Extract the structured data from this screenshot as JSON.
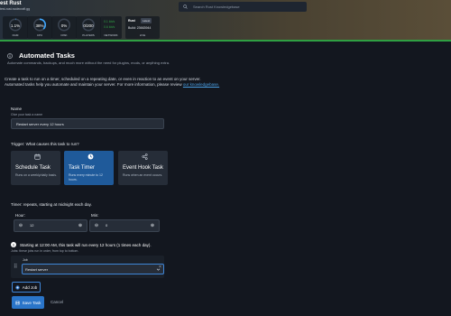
{
  "header": {
    "server_name": "est Rust",
    "server_address": "test-rust.nodecraft.gg",
    "search_placeholder": "Search Rust Knowledgebase",
    "stats": [
      {
        "value": "1.1%",
        "label": "RAM",
        "level": 0.011,
        "color": "#3fa7ff"
      },
      {
        "value": "38%",
        "label": "CPU",
        "level": 0.38,
        "color": "#3fa7ff"
      },
      {
        "value": "0%",
        "label": "DISK",
        "level": 0.0,
        "color": "#3fa7ff"
      },
      {
        "value": "0/200",
        "label": "PLAYERS",
        "level": 0.0,
        "color": "#3fa7ff"
      }
    ],
    "network": {
      "in": "0.1 kb/s",
      "out": "0.6 kb/s",
      "label": "NETWORK"
    },
    "version": {
      "name": "Rust",
      "chip": "Latest",
      "build": "Build: 23663944",
      "label": "LIVE"
    },
    "accent": "#2fa043"
  },
  "page": {
    "title": "Automated Tasks",
    "subtitle": "Automate commands, backups, and much more without the need for plugins, mods, or anything extra.",
    "intro_line1": "Create a task to run on a timer, scheduled on a repeating date, or even in reaction to an event on your server.",
    "intro_line2": "Automated tasks help you automate and maintain your server. For more information, please review",
    "intro_link": "our knowledgebase."
  },
  "form": {
    "name_label": "Name",
    "name_hint": "Give your task a name",
    "name_value": "Restart server every 12 hours",
    "trigger_label": "Trigger: What causes this task to run?",
    "triggers": [
      {
        "title": "Schedule Task",
        "desc": "Runs on a weekly/daily basis.",
        "icon": "calendar-icon",
        "active": false
      },
      {
        "title": "Task Timer",
        "desc": "Runs every minute to 12 hours.",
        "icon": "clock-icon",
        "active": true
      },
      {
        "title": "Event Hook Task",
        "desc": "Runs when an event occurs.",
        "icon": "share-icon",
        "active": false
      }
    ],
    "timer_label": "Timer: repeats, starting at midnight each day.",
    "hour_label": "Hour:",
    "hour_value": "12",
    "min_label": "Min:",
    "min_value": "0",
    "minus": "⊖",
    "plus": "⊕",
    "summary": "Starting at 12:00 AM, this task will run every 12 hours (1 times each day).",
    "summary_sub": "Jobs: these jobs run in order, from top to bottom.",
    "info_symbol": "!",
    "job_label": "Job",
    "job_value": "Restart server",
    "handle_symbol": "⠿",
    "remove_symbol": "×",
    "add_job": "Add Job",
    "save": "Save Task",
    "cancel": "Cancel"
  }
}
